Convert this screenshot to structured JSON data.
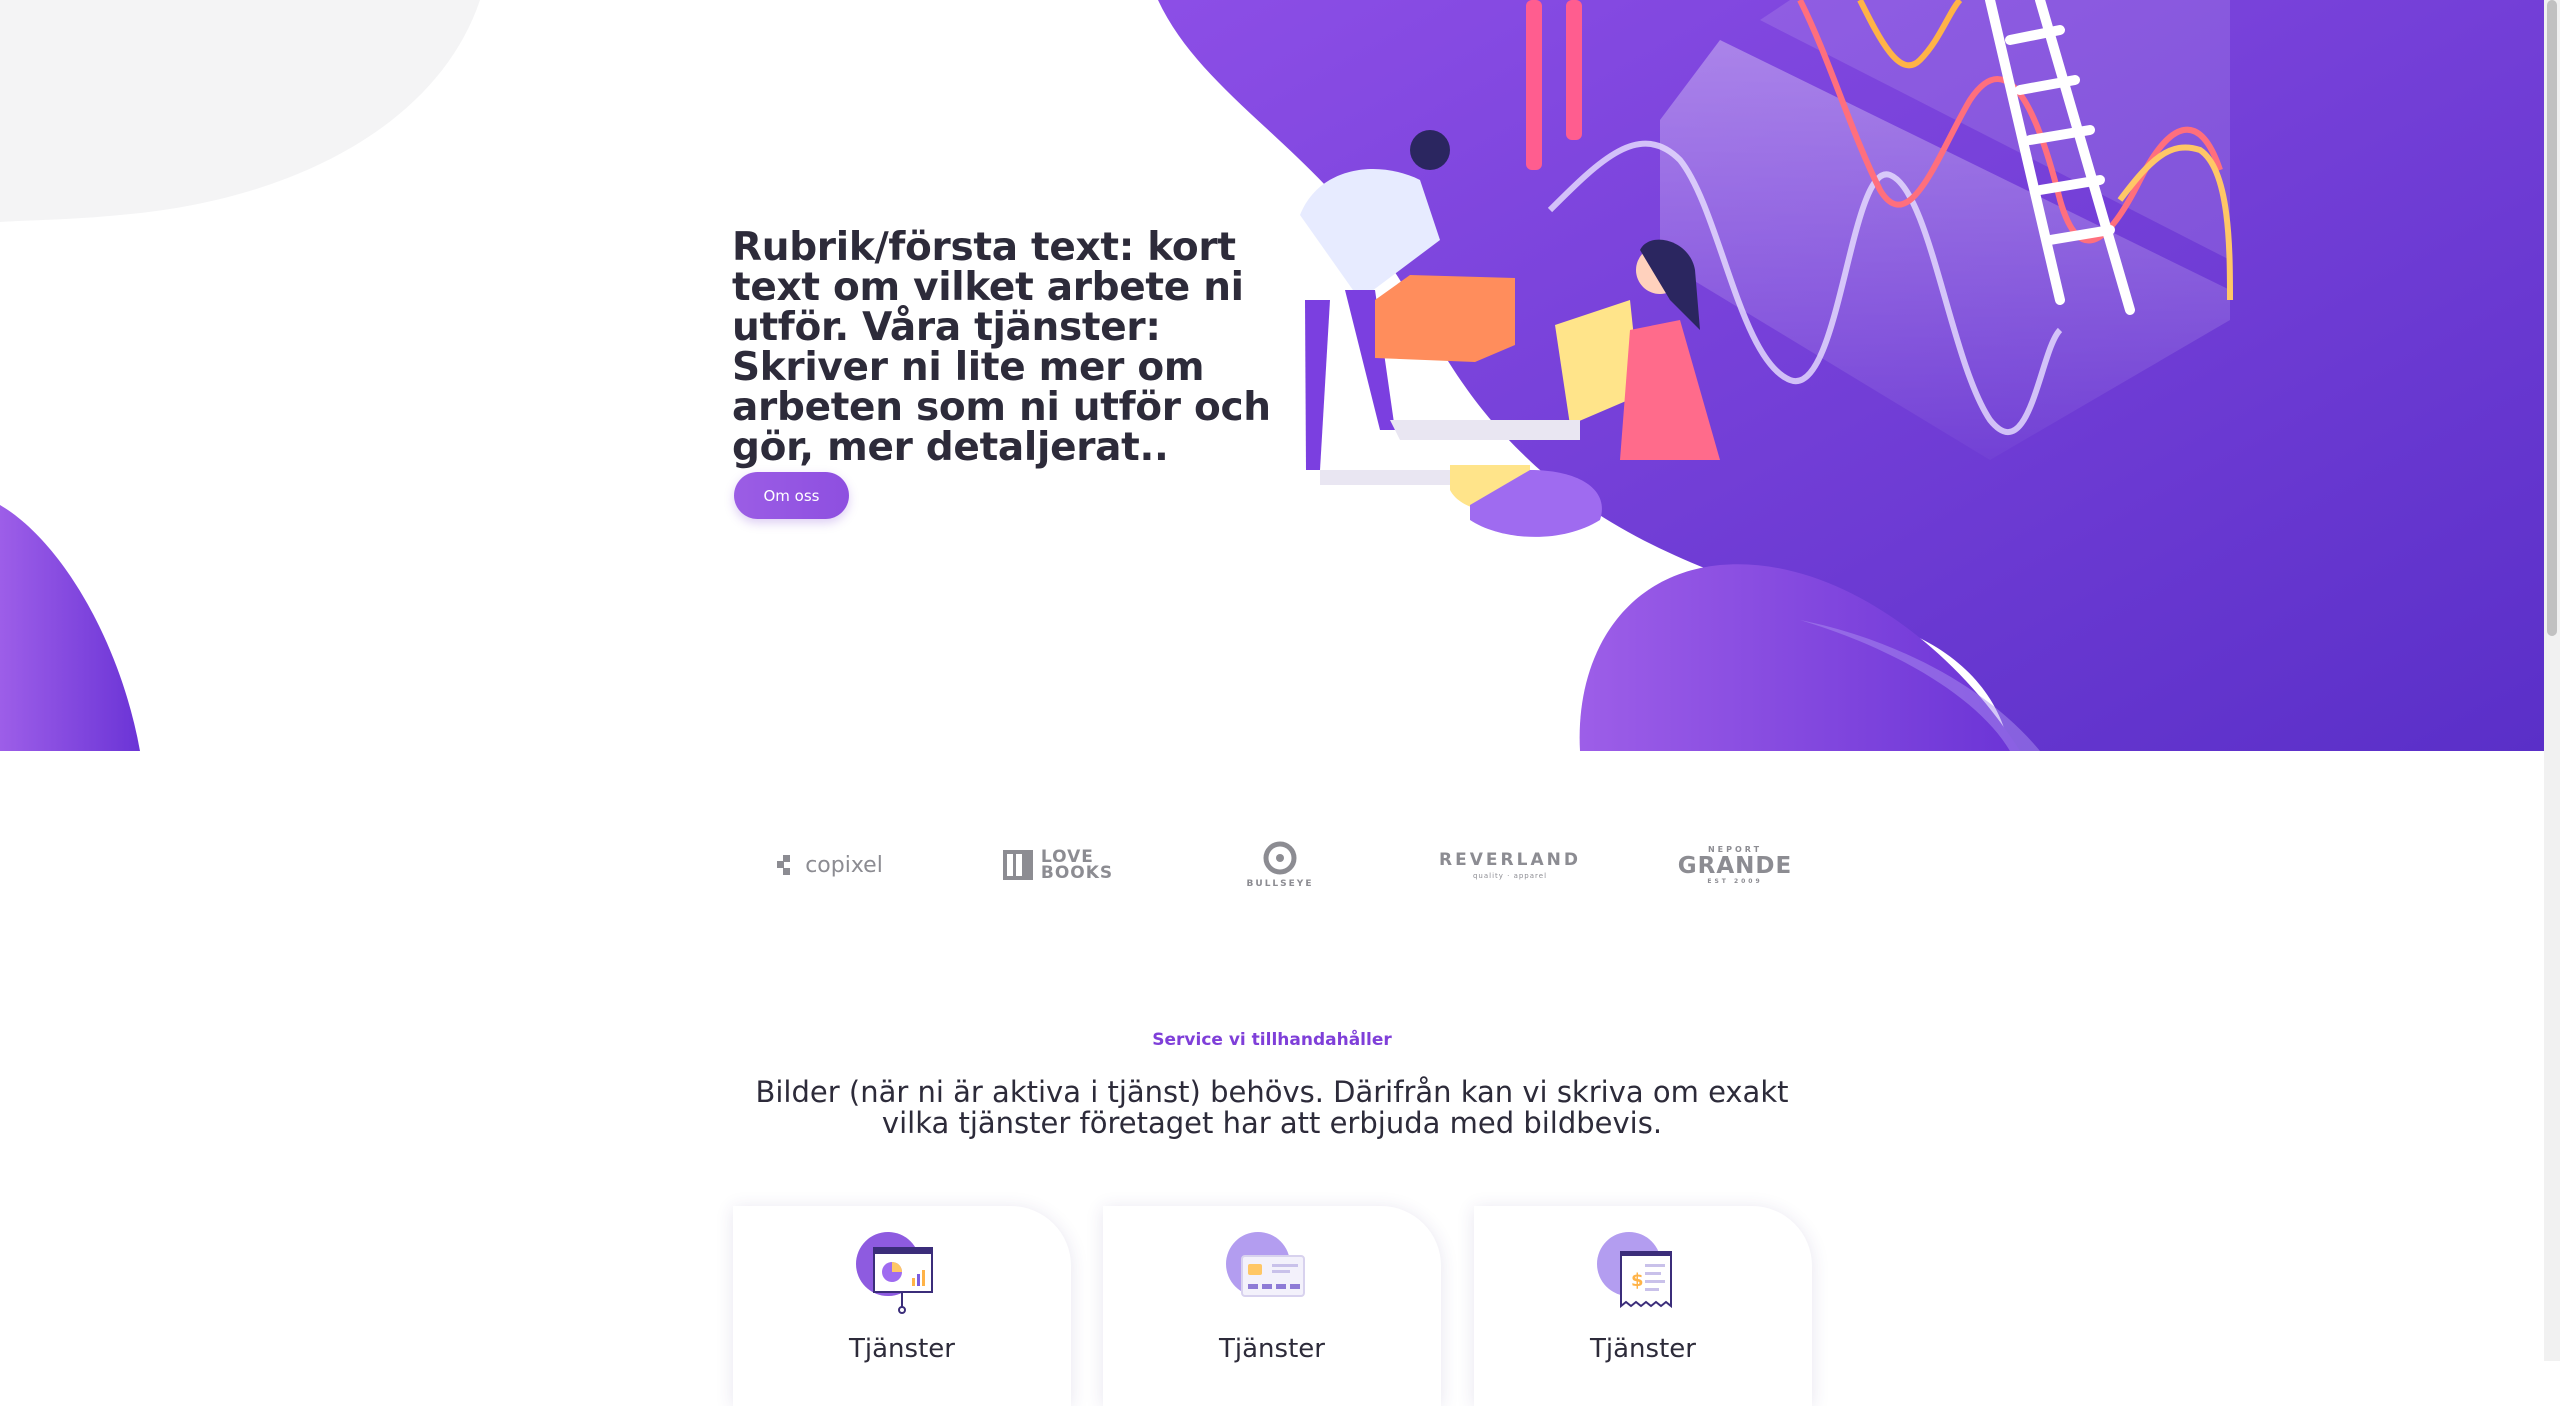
{
  "hero": {
    "headline": "Rubrik/första text: kort text om vilket arbete ni utför. Våra tjänster: Skriver ni lite mer om arbeten som ni utför och gör, mer detaljerat..",
    "cta_label": "Om oss"
  },
  "logos": [
    {
      "name": "copixel",
      "text": "copixel"
    },
    {
      "name": "love-books",
      "line1": "LOVE",
      "line2": "BOOKS"
    },
    {
      "name": "bullseye",
      "text": "BULLSEYE"
    },
    {
      "name": "reverland",
      "text": "REVERLAND",
      "sub": "quality · apparel"
    },
    {
      "name": "grande",
      "small": "NEPORT",
      "text": "GRANDE",
      "tiny": "EST 2009"
    }
  ],
  "services": {
    "eyebrow": "Service vi tillhandahåller",
    "lead": "Bilder (när ni är aktiva i tjänst) behövs. Därifrån kan vi skriva om exakt vilka tjänster företaget har att erbjuda med bildbevis.",
    "cards": [
      {
        "title": "Tjänster",
        "icon": "presentation-chart-icon"
      },
      {
        "title": "Tjänster",
        "icon": "credit-card-icon"
      },
      {
        "title": "Tjänster",
        "icon": "receipt-dollar-icon"
      }
    ]
  },
  "colors": {
    "accent": "#8e4fe0",
    "accent_dark": "#5b2fc9",
    "text": "#2d2b3a",
    "logo_gray": "#8c8c92"
  }
}
